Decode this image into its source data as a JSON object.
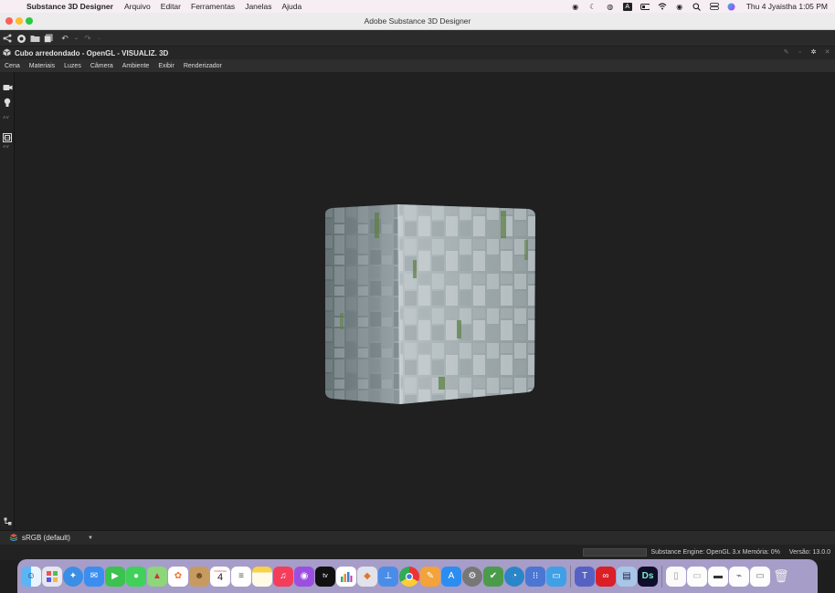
{
  "menubar": {
    "app_name": "Substance 3D Designer",
    "items": [
      "Arquivo",
      "Editar",
      "Ferramentas",
      "Janelas",
      "Ajuda"
    ],
    "clock": "Thu 4 Jyaistha  1:05 PM"
  },
  "window": {
    "title": "Adobe Substance 3D Designer"
  },
  "panel": {
    "title": "Cubo arredondado - OpenGL - VISUALIZ. 3D"
  },
  "viewport_menu": {
    "items": [
      "Cena",
      "Materiais",
      "Luzes",
      "Câmera",
      "Ambiente",
      "Exibir",
      "Renderizador"
    ]
  },
  "colorspace": {
    "value": "sRGB (default)"
  },
  "status": {
    "engine": "Substance Engine: OpenGL 3.x  Memória: 0%",
    "version": "Versão: 13.0.0"
  },
  "calendar": {
    "month": "JYAISTHA",
    "day": "4"
  },
  "colors": {
    "accent_ds": "#0e0e2a",
    "viewport_bg": "#202020",
    "dock_bg": "#bdb4e6"
  }
}
